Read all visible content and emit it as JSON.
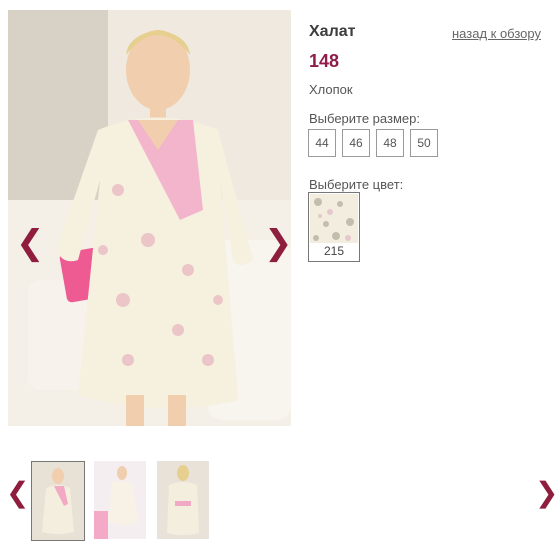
{
  "product": {
    "title": "Халат",
    "price": "148",
    "material": "Хлопок",
    "back_link": "назад к обзору"
  },
  "sizes": {
    "label": "Выберите размер:",
    "options": [
      "44",
      "46",
      "48",
      "50"
    ]
  },
  "colors": {
    "label": "Выберите цвет:",
    "options": [
      {
        "code": "215",
        "image": "floral-cream-pattern"
      }
    ]
  },
  "gallery": {
    "prev_icon": "chevron-left-icon",
    "next_icon": "chevron-right-icon",
    "thumb_count": 3,
    "active_thumb": 1
  },
  "colors_palette": {
    "accent": "#8f1d3d",
    "pink_trim": "#f2a9c3",
    "robe": "#f4eedf"
  }
}
